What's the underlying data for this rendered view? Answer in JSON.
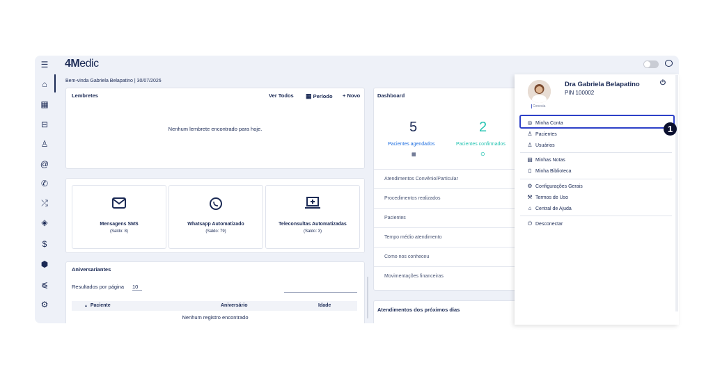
{
  "logo": {
    "prefix": "4M",
    "rest": "edic"
  },
  "welcome": "Bem-vinda Gabriela Belapatino | 30/07/2026",
  "sidebar": {
    "icons": [
      "menu-icon",
      "home-icon",
      "calendar-icon",
      "sofa-icon",
      "user-icon",
      "at-icon",
      "phone-icon",
      "arrows-icon",
      "tag-icon",
      "dollar-icon",
      "box-icon",
      "chart-icon",
      "gear-icon"
    ]
  },
  "reminders": {
    "title": "Lembretes",
    "view_all": "Ver Todos",
    "period": "Período",
    "new": "+ Novo",
    "empty": "Nenhum lembrete encontrado para hoje."
  },
  "services": [
    {
      "name": "Mensagens SMS",
      "balance": "(Saldo: 8)",
      "icon": "envelope-icon"
    },
    {
      "name": "Whatsapp Automatizado",
      "balance": "(Saldo: 79)",
      "icon": "whatsapp-icon"
    },
    {
      "name": "Teleconsultas Automatizadas",
      "balance": "(Saldo: 3)",
      "icon": "laptop-plus-icon"
    }
  ],
  "birthdays": {
    "title": "Aniversariantes",
    "per_page_label": "Resultados por página",
    "per_page_value": "10",
    "columns": [
      "Paciente",
      "Aniversário",
      "Idade"
    ],
    "empty": "Nenhum registro encontrado"
  },
  "dashboard": {
    "title": "Dashboard",
    "scheduled_count": "5",
    "scheduled_label": "Pacientes agendados",
    "confirmed_count": "2",
    "confirmed_label": "Pacientes confirmados",
    "rows": [
      "Atendimentos Convênio/Particular",
      "Procedimentos realizados",
      "Pacientes",
      "Tempo médio atendimento",
      "Como nos conheceu",
      "Movimentações financeiras"
    ],
    "next_title": "Atendimentos dos próximos dias"
  },
  "profile_menu": {
    "name": "Dra Gabriela Belapatino",
    "pin": "PIN 100002",
    "tag": "Conesia",
    "items": [
      {
        "label": "Minha Conta",
        "icon": "user-circle-icon"
      },
      {
        "label": "Pacientes",
        "icon": "patients-icon"
      },
      {
        "label": "Usuários",
        "icon": "users-icon"
      },
      {
        "label": "Minhas Notas",
        "icon": "notes-icon"
      },
      {
        "label": "Minha Biblioteca",
        "icon": "book-icon"
      },
      {
        "label": "Configurações Gerais",
        "icon": "gear-icon"
      },
      {
        "label": "Termos de Uso",
        "icon": "gavel-icon"
      },
      {
        "label": "Central de Ajuda",
        "icon": "graduation-icon"
      },
      {
        "label": "Desconectar",
        "icon": "power-icon"
      }
    ]
  },
  "annotation": {
    "step": "1"
  },
  "colors": {
    "navy": "#1b2a55",
    "accent_blue": "#1f6fe0",
    "teal": "#23c3b1",
    "highlight": "#2d40c8"
  }
}
